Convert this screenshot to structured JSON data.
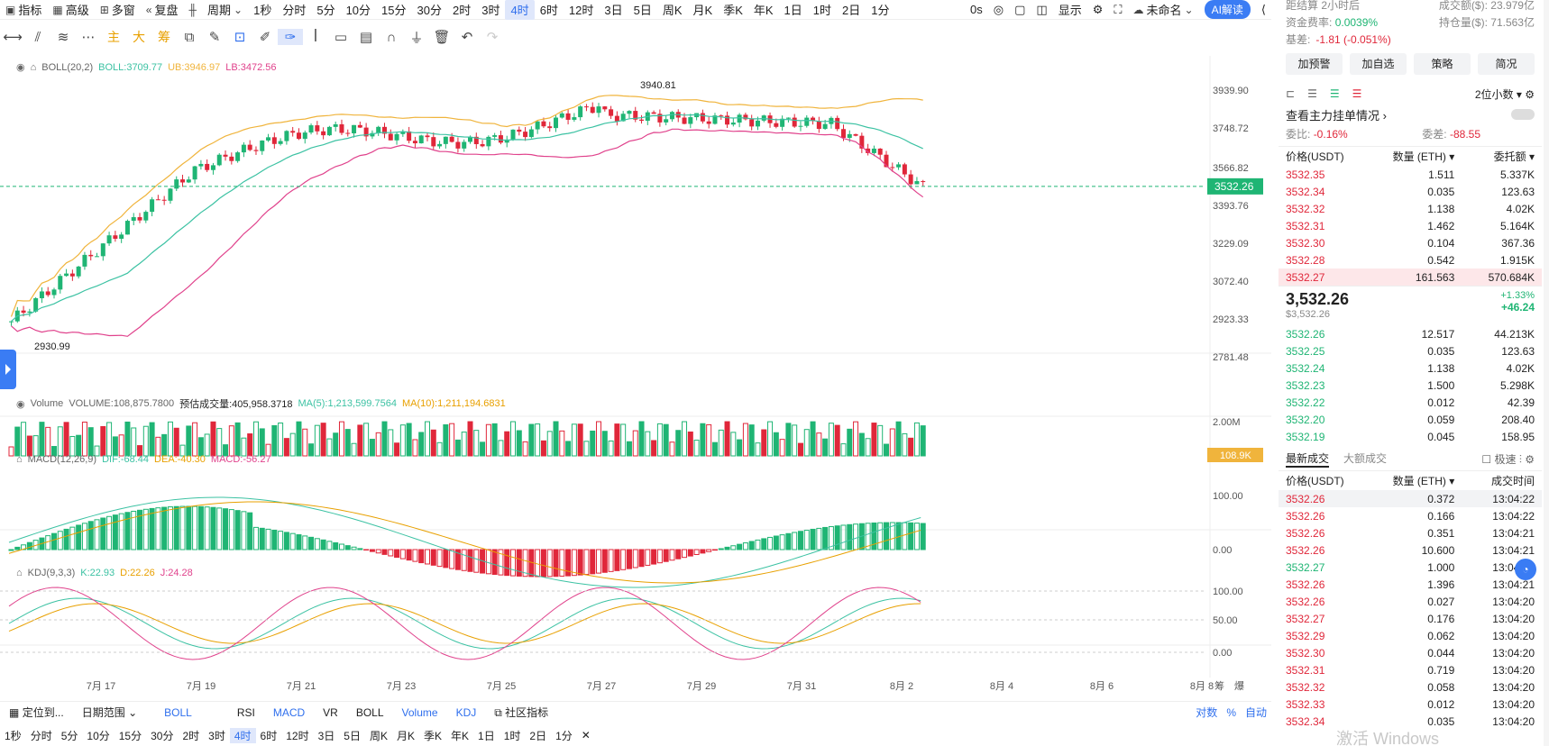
{
  "topbar": {
    "items": [
      "指标",
      "高级",
      "多窗",
      "复盘",
      "周期",
      "1秒",
      "分时",
      "5分",
      "10分",
      "15分",
      "30分",
      "2时",
      "3时",
      "4时",
      "6时",
      "12时",
      "3日",
      "5日",
      "周K",
      "月K",
      "季K",
      "年K",
      "1日",
      "1时",
      "2日",
      "1分"
    ],
    "active": "4时",
    "countdown": "0s",
    "display": "显示",
    "unnamed": "未命名",
    "ai": "AI解读"
  },
  "drawing_tools": {
    "main": "主",
    "big": "大",
    "chips": "筹"
  },
  "indicators": {
    "boll": {
      "name": "BOLL(20,2)",
      "boll": "BOLL:3709.77",
      "ub": "UB:3946.97",
      "lb": "LB:3472.56"
    },
    "volume": {
      "name": "Volume",
      "vol": "VOLUME:108,875.7800",
      "est": "预估成交量:405,958.3718",
      "ma5": "MA(5):1,213,599.7564",
      "ma10": "MA(10):1,211,194.6831"
    },
    "macd": {
      "name": "MACD(12,26,9)",
      "dif": "DIF:-68.44",
      "dea": "DEA:-40.30",
      "macd": "MACD:-56.27"
    },
    "kdj": {
      "name": "KDJ(9,3,3)",
      "k": "K:22.93",
      "d": "D:22.26",
      "j": "J:24.28"
    }
  },
  "price_axis": {
    "labels": [
      "3939.90",
      "3748.72",
      "3566.82",
      "3393.76",
      "3229.09",
      "3072.40",
      "2923.33",
      "2781.48"
    ],
    "current": "3532.26",
    "vol_label": "2.00M",
    "vol_current": "108.9K",
    "macd_labels": [
      "100.00",
      "0.00"
    ],
    "kdj_labels": [
      "100.00",
      "50.00",
      "0.00"
    ]
  },
  "annotations": {
    "high": "3940.81",
    "low": "2930.99"
  },
  "date_axis": [
    "7月 17",
    "7月 19",
    "7月 21",
    "7月 23",
    "7月 25",
    "7月 27",
    "7月 29",
    "7月 31",
    "8月 2",
    "8月 4",
    "8月 6",
    "8月 8"
  ],
  "axis_modes": {
    "a": "筹",
    "b": "爆"
  },
  "bottombar": {
    "locate": "定位到...",
    "range": "日期范围",
    "tabs": [
      "BOLL",
      "RSI",
      "MACD",
      "VR",
      "BOLL",
      "Volume",
      "KDJ"
    ],
    "community": "社区指标",
    "right": [
      "对数",
      "%",
      "自动"
    ]
  },
  "bottombar2": {
    "items": [
      "1秒",
      "分时",
      "5分",
      "10分",
      "15分",
      "30分",
      "2时",
      "3时",
      "4时",
      "6时",
      "12时",
      "3日",
      "5日",
      "周K",
      "月K",
      "季K",
      "年K",
      "1日",
      "1时",
      "2日",
      "1分"
    ],
    "active": "4时"
  },
  "right_panel": {
    "settle_label": "距结算",
    "settle": "2小时后",
    "turnover_label": "成交额($):",
    "turnover": "23.979亿",
    "funding_label": "资金费率:",
    "funding": "0.0039%",
    "oi_label": "持仓量($):",
    "oi": "71.563亿",
    "basis_label": "基差:",
    "basis": "-1.81 (-0.051%)",
    "buttons": [
      "加预警",
      "加自选",
      "策略",
      "简况"
    ],
    "decimals": "2位小数",
    "main_orders": "查看主力挂单情况",
    "ratio_label": "委比:",
    "ratio": "-0.16%",
    "diff_label": "委差:",
    "diff": "-88.55",
    "headers": [
      "价格(USDT)",
      "数量 (ETH)",
      "委托额"
    ],
    "asks": [
      [
        "3532.35",
        "1.511",
        "5.337K"
      ],
      [
        "3532.34",
        "0.035",
        "123.63"
      ],
      [
        "3532.32",
        "1.138",
        "4.02K"
      ],
      [
        "3532.31",
        "1.462",
        "5.164K"
      ],
      [
        "3532.30",
        "0.104",
        "367.36"
      ],
      [
        "3532.28",
        "0.542",
        "1.915K"
      ],
      [
        "3532.27",
        "161.563",
        "570.684K"
      ]
    ],
    "last_price": "3,532.26",
    "last_usd": "$3,532.26",
    "change_pct": "+1.33%",
    "change": "+46.24",
    "bids": [
      [
        "3532.26",
        "12.517",
        "44.213K"
      ],
      [
        "3532.25",
        "0.035",
        "123.63"
      ],
      [
        "3532.24",
        "1.138",
        "4.02K"
      ],
      [
        "3532.23",
        "1.500",
        "5.298K"
      ],
      [
        "3532.22",
        "0.012",
        "42.39"
      ],
      [
        "3532.20",
        "0.059",
        "208.40"
      ],
      [
        "3532.19",
        "0.045",
        "158.95"
      ]
    ],
    "trade_tabs": [
      "最新成交",
      "大额成交"
    ],
    "fast": "极速",
    "trade_headers": [
      "价格(USDT)",
      "数量 (ETH)",
      "成交时间"
    ],
    "trades": [
      [
        "3532.26",
        "0.372",
        "13:04:22",
        "r"
      ],
      [
        "3532.26",
        "0.166",
        "13:04:22",
        "r"
      ],
      [
        "3532.26",
        "0.351",
        "13:04:21",
        "r"
      ],
      [
        "3532.26",
        "10.600",
        "13:04:21",
        "r"
      ],
      [
        "3532.27",
        "1.000",
        "13:04:21",
        "g"
      ],
      [
        "3532.26",
        "1.396",
        "13:04:21",
        "r"
      ],
      [
        "3532.26",
        "0.027",
        "13:04:20",
        "r"
      ],
      [
        "3532.27",
        "0.176",
        "13:04:20",
        "r"
      ],
      [
        "3532.29",
        "0.062",
        "13:04:20",
        "r"
      ],
      [
        "3532.30",
        "0.044",
        "13:04:20",
        "r"
      ],
      [
        "3532.31",
        "0.719",
        "13:04:20",
        "r"
      ],
      [
        "3532.32",
        "0.058",
        "13:04:20",
        "r"
      ],
      [
        "3532.33",
        "0.012",
        "13:04:20",
        "r"
      ],
      [
        "3532.34",
        "0.035",
        "13:04:20",
        "r"
      ]
    ],
    "watermark": "激活 Windows"
  },
  "colors": {
    "up": "#1fb574",
    "down": "#e0273a",
    "boll_mid": "#3cc2a3",
    "boll_ub": "#f0b43c",
    "boll_lb": "#e0428c",
    "accent": "#3a7cf4"
  }
}
